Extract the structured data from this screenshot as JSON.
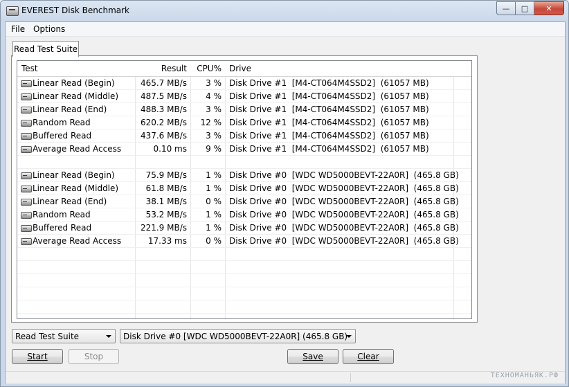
{
  "window": {
    "title": "EVEREST Disk Benchmark"
  },
  "menu": {
    "items": [
      "File",
      "Options"
    ]
  },
  "tab": {
    "label": "Read Test Suite"
  },
  "table": {
    "headers": [
      "Test",
      "Result",
      "CPU%",
      "Drive"
    ],
    "rows": [
      {
        "test": "Linear Read (Begin)",
        "result": "465.7 MB/s",
        "cpu": "3 %",
        "drive": "Disk Drive #1  [M4-CT064M4SSD2]  (61057 MB)"
      },
      {
        "test": "Linear Read (Middle)",
        "result": "487.5 MB/s",
        "cpu": "4 %",
        "drive": "Disk Drive #1  [M4-CT064M4SSD2]  (61057 MB)"
      },
      {
        "test": "Linear Read (End)",
        "result": "488.3 MB/s",
        "cpu": "3 %",
        "drive": "Disk Drive #1  [M4-CT064M4SSD2]  (61057 MB)"
      },
      {
        "test": "Random Read",
        "result": "620.2 MB/s",
        "cpu": "12 %",
        "drive": "Disk Drive #1  [M4-CT064M4SSD2]  (61057 MB)"
      },
      {
        "test": "Buffered Read",
        "result": "437.6 MB/s",
        "cpu": "3 %",
        "drive": "Disk Drive #1  [M4-CT064M4SSD2]  (61057 MB)"
      },
      {
        "test": "Average Read Access",
        "result": "0.10 ms",
        "cpu": "9 %",
        "drive": "Disk Drive #1  [M4-CT064M4SSD2]  (61057 MB)"
      },
      null,
      {
        "test": "Linear Read (Begin)",
        "result": "75.9 MB/s",
        "cpu": "1 %",
        "drive": "Disk Drive #0  [WDC WD5000BEVT-22A0R]  (465.8 GB)"
      },
      {
        "test": "Linear Read (Middle)",
        "result": "61.8 MB/s",
        "cpu": "1 %",
        "drive": "Disk Drive #0  [WDC WD5000BEVT-22A0R]  (465.8 GB)"
      },
      {
        "test": "Linear Read (End)",
        "result": "38.1 MB/s",
        "cpu": "0 %",
        "drive": "Disk Drive #0  [WDC WD5000BEVT-22A0R]  (465.8 GB)"
      },
      {
        "test": "Random Read",
        "result": "53.2 MB/s",
        "cpu": "1 %",
        "drive": "Disk Drive #0  [WDC WD5000BEVT-22A0R]  (465.8 GB)"
      },
      {
        "test": "Buffered Read",
        "result": "221.9 MB/s",
        "cpu": "1 %",
        "drive": "Disk Drive #0  [WDC WD5000BEVT-22A0R]  (465.8 GB)"
      },
      {
        "test": "Average Read Access",
        "result": "17.33 ms",
        "cpu": "0 %",
        "drive": "Disk Drive #0  [WDC WD5000BEVT-22A0R]  (465.8 GB)"
      }
    ]
  },
  "controls": {
    "suite_select": "Read Test Suite",
    "drive_select": "Disk Drive #0  [WDC WD5000BEVT-22A0R]  (465.8 GB)",
    "start_label": "Start",
    "stop_label": "Stop",
    "save_label": "Save",
    "clear_label": "Clear"
  },
  "watermark": "ТЕХНОМАНЬЯК.РФ",
  "icons": {
    "row_icon": "hard-drive-icon",
    "app_icon": "hard-drive-icon"
  }
}
